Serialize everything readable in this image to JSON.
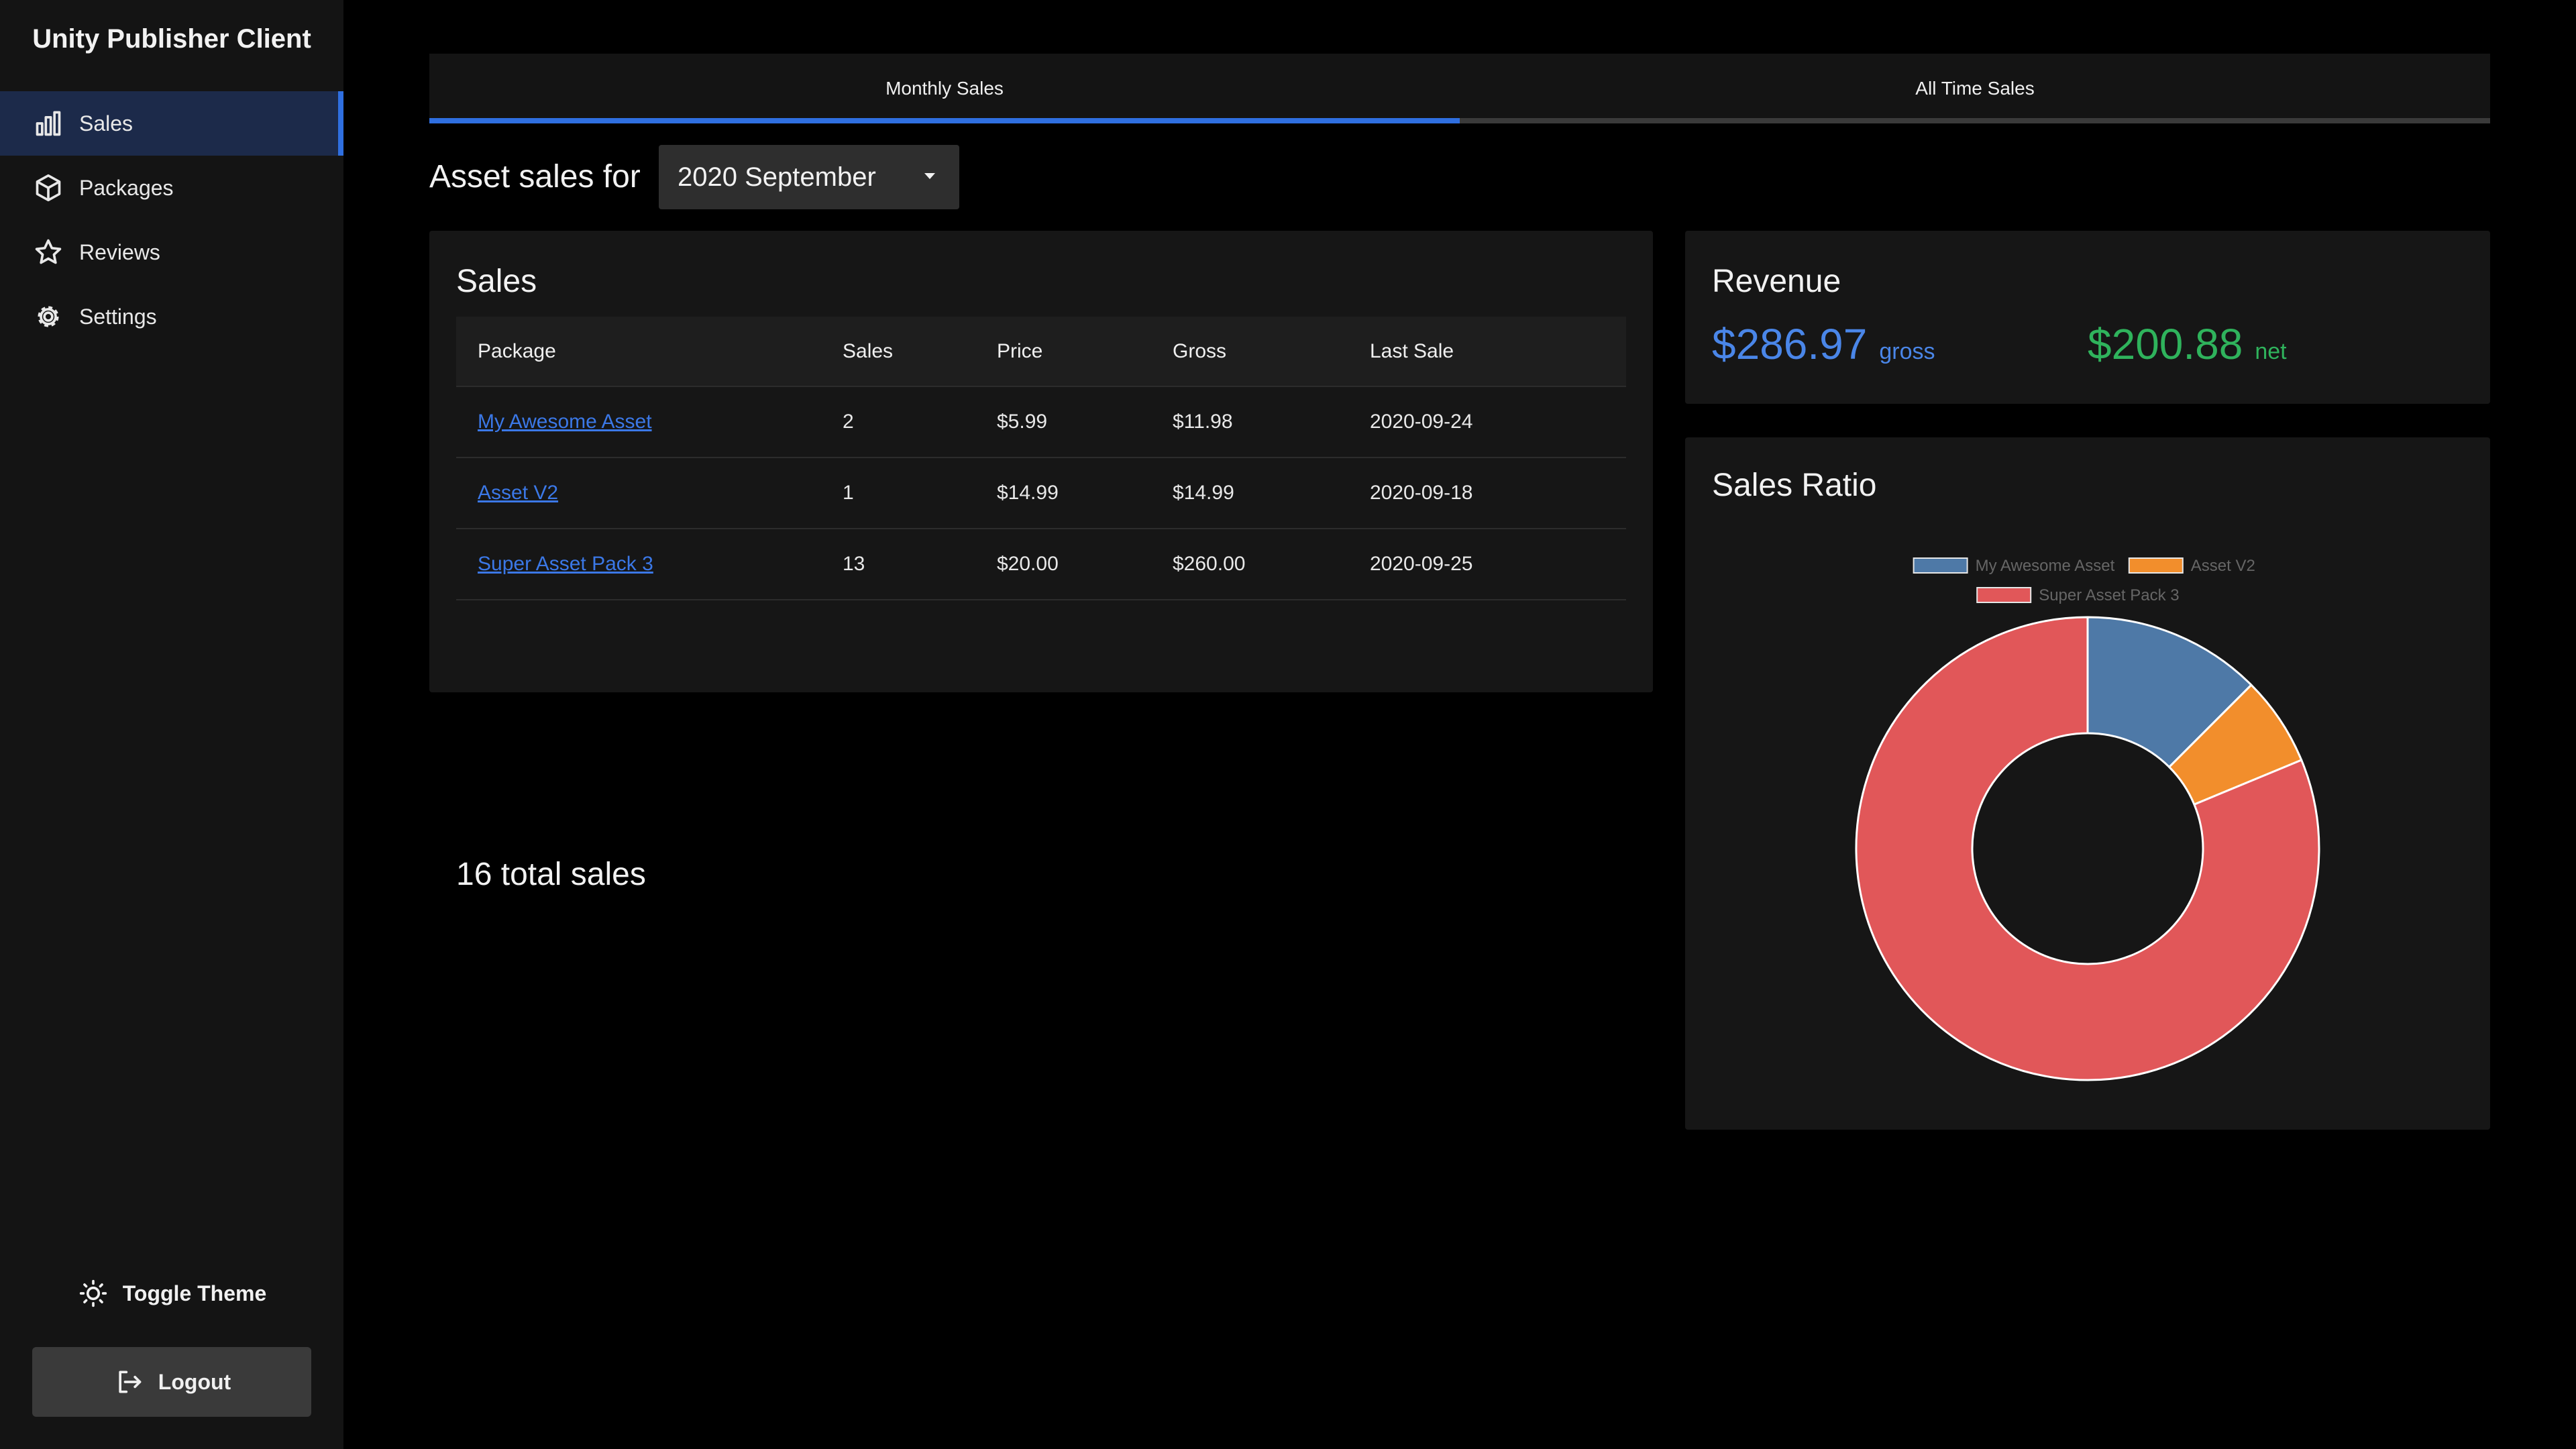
{
  "app": {
    "title": "Unity Publisher Client"
  },
  "sidebar": {
    "items": [
      {
        "label": "Sales",
        "icon": "bar-chart-icon",
        "active": true
      },
      {
        "label": "Packages",
        "icon": "package-icon",
        "active": false
      },
      {
        "label": "Reviews",
        "icon": "star-icon",
        "active": false
      },
      {
        "label": "Settings",
        "icon": "gear-icon",
        "active": false
      }
    ],
    "toggle_theme": {
      "label": "Toggle Theme",
      "icon": "sun-icon"
    },
    "logout": {
      "label": "Logout",
      "icon": "logout-icon"
    }
  },
  "tabs": [
    {
      "label": "Monthly Sales",
      "active": true
    },
    {
      "label": "All Time Sales",
      "active": false
    }
  ],
  "header": {
    "prefix": "Asset sales for",
    "period": "2020 September"
  },
  "sales": {
    "title": "Sales",
    "columns": [
      "Package",
      "Sales",
      "Price",
      "Gross",
      "Last Sale"
    ],
    "rows": [
      {
        "package": "My Awesome Asset",
        "sales": "2",
        "price": "$5.99",
        "gross": "$11.98",
        "last_sale": "2020-09-24"
      },
      {
        "package": "Asset V2",
        "sales": "1",
        "price": "$14.99",
        "gross": "$14.99",
        "last_sale": "2020-09-18"
      },
      {
        "package": "Super Asset Pack 3",
        "sales": "13",
        "price": "$20.00",
        "gross": "$260.00",
        "last_sale": "2020-09-25"
      }
    ],
    "total": "16 total sales"
  },
  "revenue": {
    "title": "Revenue",
    "gross_value": "$286.97",
    "gross_label": "gross",
    "net_value": "$200.88",
    "net_label": "net"
  },
  "ratio": {
    "title": "Sales Ratio"
  },
  "colors": {
    "accent": "#2f6fe0",
    "gross": "#4a86e8",
    "net": "#2fb35c"
  },
  "chart_data": {
    "type": "pie",
    "style": "doughnut",
    "title": "",
    "legend_position": "top",
    "categories": [
      "My Awesome Asset",
      "Asset V2",
      "Super Asset Pack 3"
    ],
    "values": [
      2,
      1,
      13
    ],
    "colors": [
      "#4e79a7",
      "#f28e2c",
      "#e15759"
    ]
  }
}
